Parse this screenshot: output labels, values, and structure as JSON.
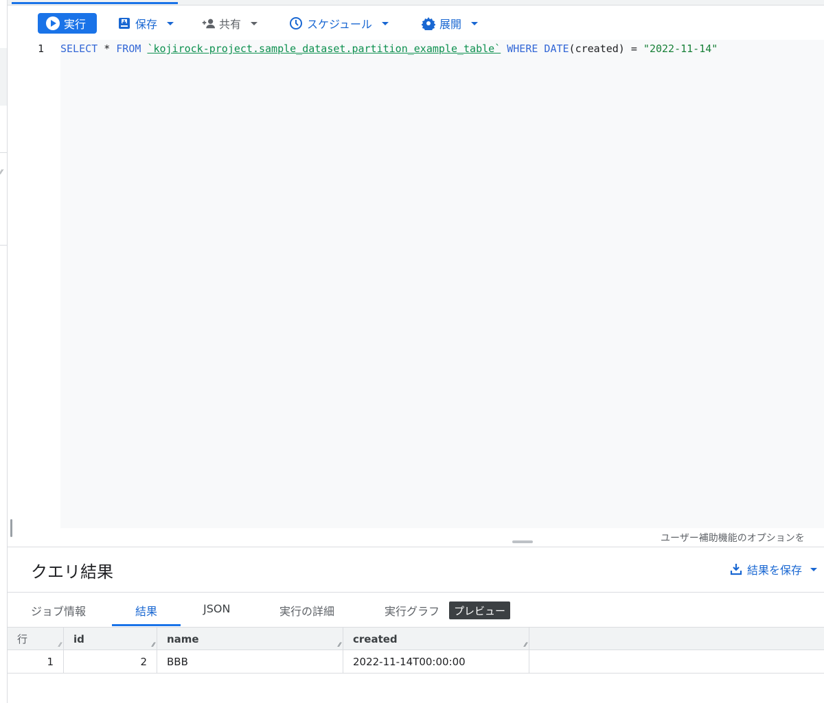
{
  "toolbar": {
    "run_label": "実行",
    "save_label": "保存",
    "share_label": "共有",
    "schedule_label": "スケジュール",
    "deploy_label": "展開"
  },
  "editor": {
    "line_number": "1",
    "tokens": {
      "select": "SELECT",
      "star": " * ",
      "from": "FROM",
      "table": "`kojirock-project.sample_dataset.partition_example_table`",
      "where": "WHERE",
      "date_fn": "DATE",
      "args": "(created) = ",
      "value": "\"2022-11-14\""
    },
    "a11y_hint": "ユーザー補助機能のオプションを"
  },
  "results": {
    "title": "クエリ結果",
    "save_results_label": "結果を保存",
    "tabs": [
      "ジョブ情報",
      "結果",
      "JSON",
      "実行の詳細",
      "実行グラフ"
    ],
    "active_tab": "結果",
    "preview_badge": "プレビュー",
    "columns": [
      "行",
      "id",
      "name",
      "created"
    ],
    "rows": [
      {
        "row": "1",
        "id": "2",
        "name": "BBB",
        "created": "2022-11-14T00:00:00"
      }
    ]
  },
  "colors": {
    "accent": "#1a73e8",
    "link": "#1967d2",
    "keyword": "#3367d6",
    "string": "#188038"
  }
}
